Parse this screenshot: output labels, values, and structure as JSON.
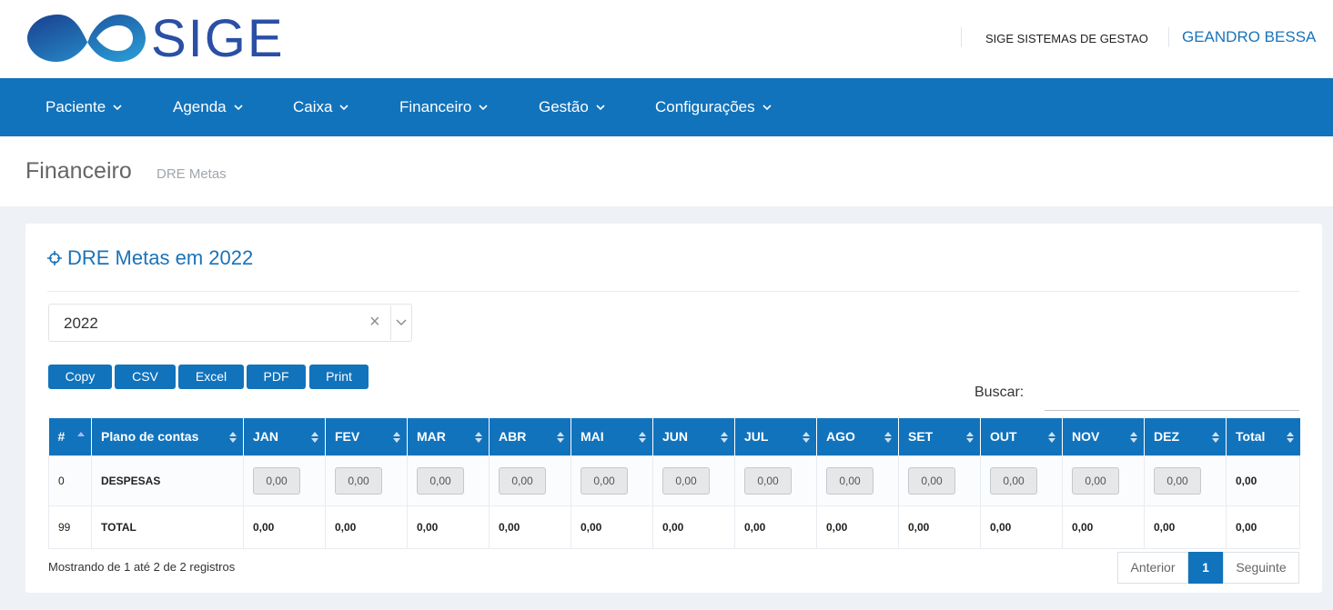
{
  "header": {
    "logo_text": "SIGE",
    "company": "SIGE SISTEMAS DE GESTAO",
    "user": "GEANDRO BESSA"
  },
  "nav": [
    {
      "label": "Paciente"
    },
    {
      "label": "Agenda"
    },
    {
      "label": "Caixa"
    },
    {
      "label": "Financeiro"
    },
    {
      "label": "Gestão"
    },
    {
      "label": "Configurações"
    }
  ],
  "page": {
    "title": "Financeiro",
    "subtitle": "DRE Metas"
  },
  "portlet": {
    "title": "DRE Metas em 2022",
    "year_select": "2022",
    "clear_symbol": "×"
  },
  "export_buttons": [
    {
      "label": "Copy"
    },
    {
      "label": "CSV"
    },
    {
      "label": "Excel"
    },
    {
      "label": "PDF"
    },
    {
      "label": "Print"
    }
  ],
  "search": {
    "label": "Buscar:",
    "value": ""
  },
  "table": {
    "columns": [
      "#",
      "Plano de contas",
      "JAN",
      "FEV",
      "MAR",
      "ABR",
      "MAI",
      "JUN",
      "JUL",
      "AGO",
      "SET",
      "OUT",
      "NOV",
      "DEZ",
      "Total"
    ],
    "rows": [
      {
        "id": "0",
        "name": "DESPESAS",
        "months": [
          "0,00",
          "0,00",
          "0,00",
          "0,00",
          "0,00",
          "0,00",
          "0,00",
          "0,00",
          "0,00",
          "0,00",
          "0,00",
          "0,00"
        ],
        "total": "0,00",
        "editable": true
      },
      {
        "id": "99",
        "name": "TOTAL",
        "months": [
          "0,00",
          "0,00",
          "0,00",
          "0,00",
          "0,00",
          "0,00",
          "0,00",
          "0,00",
          "0,00",
          "0,00",
          "0,00",
          "0,00"
        ],
        "total": "0,00",
        "editable": false
      }
    ]
  },
  "footer": {
    "info": "Mostrando de 1 até 2 de 2 registros",
    "prev": "Anterior",
    "page": "1",
    "next": "Seguinte"
  },
  "colors": {
    "primary": "#1173bc",
    "link": "#1a73b8"
  }
}
